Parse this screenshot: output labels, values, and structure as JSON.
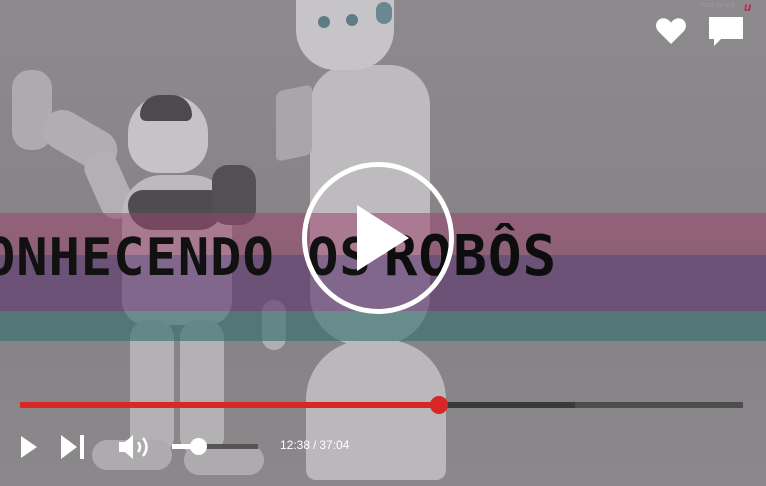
{
  "video": {
    "title_part1": "ONHECENDO OS",
    "title_part2": "ROBÔS",
    "corner_mark": "u",
    "corner_tiny": "nota do vid"
  },
  "actions": {
    "like_icon": "heart-icon",
    "comment_icon": "comment-icon"
  },
  "player": {
    "big_play_icon": "play-icon",
    "progress_fraction": 0.5793,
    "buffered_fraction": 0.7676,
    "volume_fraction": 0.3,
    "current_time": "12:38",
    "time_separator": "/",
    "duration": "37:04"
  },
  "controls": {
    "play_icon": "play-icon",
    "next_icon": "skip-next-icon",
    "volume_icon": "volume-icon"
  },
  "colors": {
    "accent": "#d92626",
    "overlay_pink": "#98466e",
    "overlay_purple": "#5c346e",
    "overlay_teal": "#34706e"
  }
}
